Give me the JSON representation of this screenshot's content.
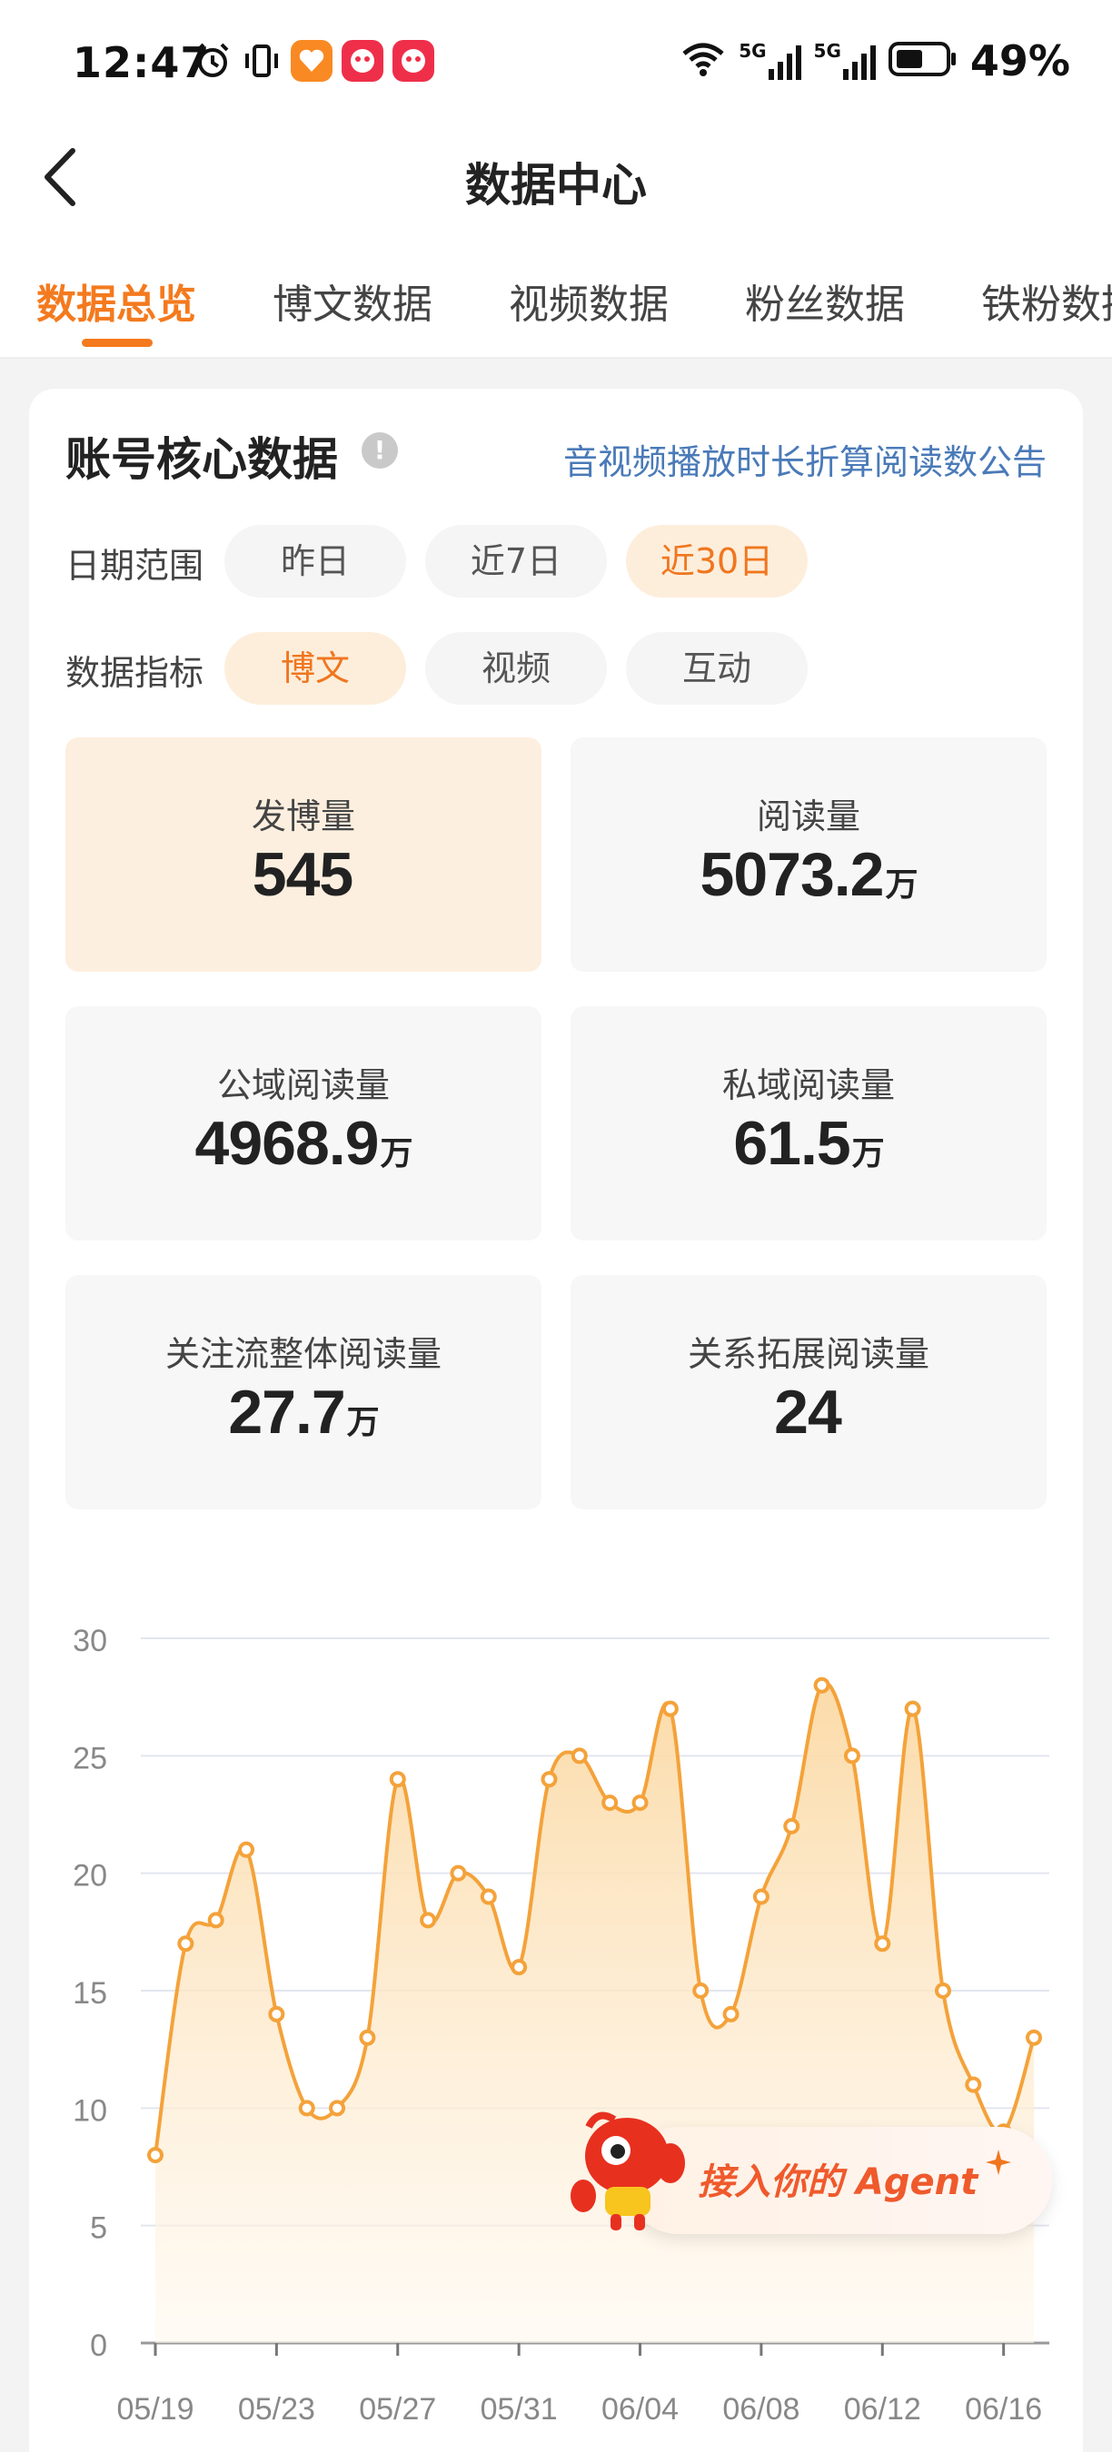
{
  "status_bar": {
    "time": "12:47",
    "network1": "5G",
    "network2": "5G",
    "battery": "49%"
  },
  "header": {
    "title": "数据中心"
  },
  "tabs": [
    {
      "label": "数据总览",
      "active": true
    },
    {
      "label": "博文数据"
    },
    {
      "label": "视频数据"
    },
    {
      "label": "粉丝数据"
    },
    {
      "label": "铁粉数据"
    }
  ],
  "card": {
    "title": "账号核心数据",
    "info_icon": "!",
    "notice_link": "音视频播放时长折算阅读数公告",
    "date_range": {
      "label": "日期范围",
      "options": [
        "昨日",
        "近7日",
        "近30日"
      ],
      "selected": "近30日"
    },
    "metric": {
      "label": "数据指标",
      "options": [
        "博文",
        "视频",
        "互动"
      ],
      "selected": "博文"
    },
    "stats": [
      {
        "label": "发博量",
        "value": "545",
        "unit": ""
      },
      {
        "label": "阅读量",
        "value": "5073.2",
        "unit": "万"
      },
      {
        "label": "公域阅读量",
        "value": "4968.9",
        "unit": "万"
      },
      {
        "label": "私域阅读量",
        "value": "61.5",
        "unit": "万"
      },
      {
        "label": "关注流整体阅读量",
        "value": "27.7",
        "unit": "万"
      },
      {
        "label": "关系拓展阅读量",
        "value": "24",
        "unit": ""
      }
    ]
  },
  "chart_data": {
    "type": "area",
    "title": "",
    "xlabel": "",
    "ylabel": "",
    "ylim": [
      0,
      30
    ],
    "yticks": [
      0,
      5,
      10,
      15,
      20,
      25,
      30
    ],
    "xtick_labels": [
      "05/19",
      "05/23",
      "05/27",
      "05/31",
      "06/04",
      "06/08",
      "06/12",
      "06/16"
    ],
    "x": [
      "05/19",
      "05/20",
      "05/21",
      "05/22",
      "05/23",
      "05/24",
      "05/25",
      "05/26",
      "05/27",
      "05/28",
      "05/29",
      "05/30",
      "05/31",
      "06/01",
      "06/02",
      "06/03",
      "06/04",
      "06/05",
      "06/06",
      "06/07",
      "06/08",
      "06/09",
      "06/10",
      "06/11",
      "06/12",
      "06/13",
      "06/14",
      "06/15",
      "06/16",
      "06/17"
    ],
    "values": [
      8,
      17,
      18,
      21,
      14,
      10,
      10,
      13,
      24,
      18,
      20,
      19,
      16,
      24,
      25,
      23,
      23,
      27,
      15,
      14,
      19,
      22,
      28,
      25,
      17,
      27,
      15,
      11,
      9,
      13
    ],
    "colors": {
      "line": "#f4a23a",
      "fill_top": "#fbd9a4",
      "fill_bottom": "#fff8ee",
      "grid": "#e3e6ef"
    }
  },
  "agent_promo": {
    "label": "接入你的 Agent"
  },
  "colors": {
    "accent": "#f47a1e",
    "link": "#4a7ab8"
  }
}
